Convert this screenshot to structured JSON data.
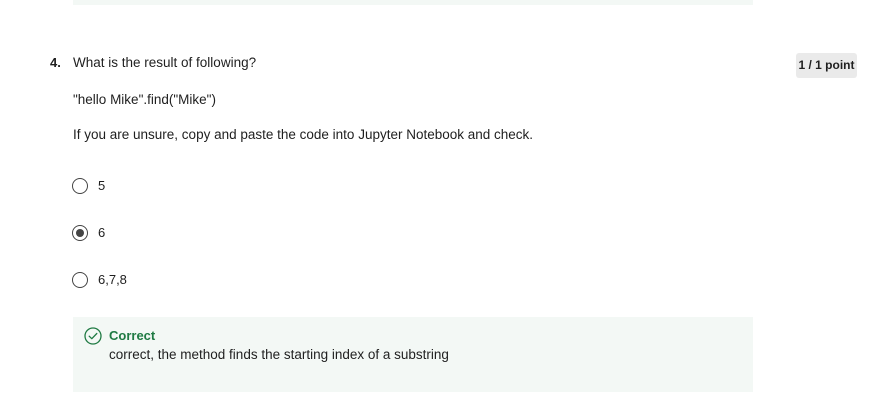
{
  "question": {
    "number": "4.",
    "prompt": "What is the result of following?",
    "code": "\"hello Mike\".find(\"Mike\")",
    "hint": "If you are unsure, copy and paste the code into Jupyter Notebook and check.",
    "score": "1 / 1 point"
  },
  "options": [
    {
      "label": "5",
      "selected": false
    },
    {
      "label": "6",
      "selected": true
    },
    {
      "label": "6,7,8",
      "selected": false
    }
  ],
  "feedback": {
    "title": "Correct",
    "text": "correct, the method finds the starting index of a substring",
    "icon": "check-circle-icon",
    "accent_color": "#1f7a43",
    "background_color": "#f3f8f5"
  }
}
